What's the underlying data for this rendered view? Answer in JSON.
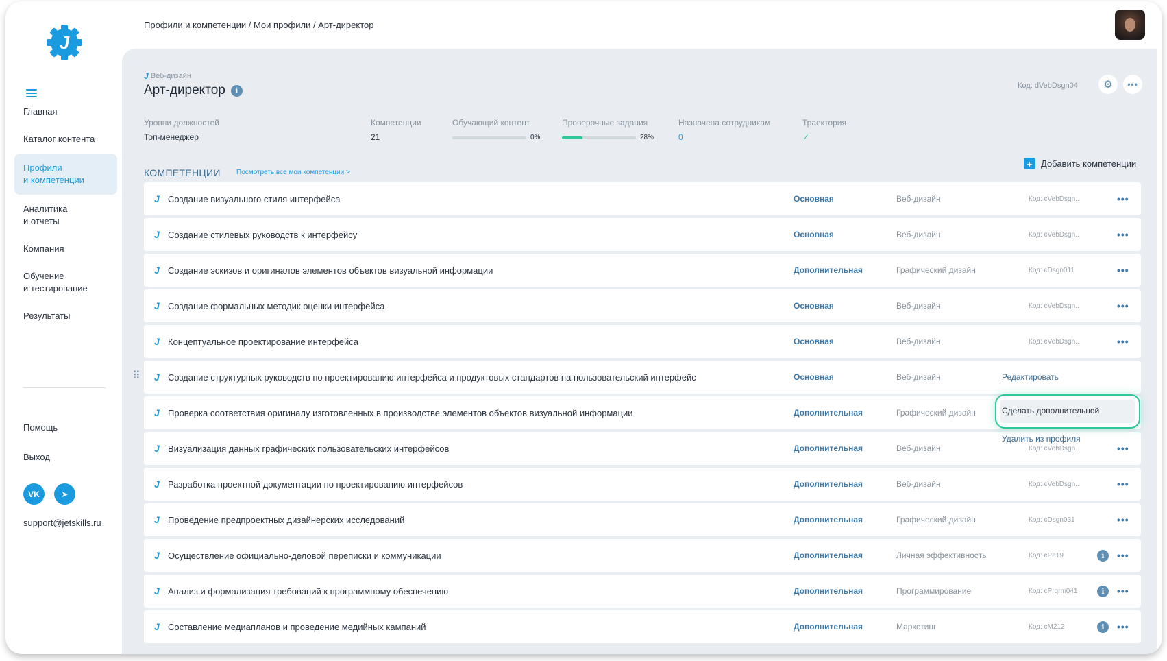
{
  "app": {
    "logo_letter": "J",
    "accent_color": "#1a9be0",
    "success_color": "#2cc89b"
  },
  "sidebar": {
    "items": [
      {
        "label": "Главная"
      },
      {
        "label": "Каталог контента"
      },
      {
        "label": "Профили\nи компетенции",
        "active": true
      },
      {
        "label": "Аналитика\nи отчеты"
      },
      {
        "label": "Компания"
      },
      {
        "label": "Обучение\nи тестирование"
      },
      {
        "label": "Результаты"
      }
    ],
    "help": "Помощь",
    "logout": "Выход",
    "social": [
      {
        "icon": "vk-icon",
        "text": "VK"
      },
      {
        "icon": "telegram-icon",
        "text": "➤"
      }
    ],
    "support_email": "support@jetskills.ru"
  },
  "header": {
    "breadcrumb": "Профили и компетенции / Мои профили / Арт-директор"
  },
  "profile": {
    "category": "Веб-дизайн",
    "title": "Арт-директор",
    "code": "Код: dVebDsgn04",
    "stats": {
      "levels_label": "Уровни должностей",
      "levels_value": "Топ-менеджер",
      "competencies_label": "Компетенции",
      "competencies_value": "21",
      "content_label": "Обучающий контент",
      "content_progress": 0,
      "content_pct": "0%",
      "tasks_label": "Проверочные задания",
      "tasks_progress": 0.28,
      "tasks_pct": "28%",
      "assigned_label": "Назначена сотрудникам",
      "assigned_value": "0",
      "trajectory_label": "Траектория",
      "trajectory_value": "✓"
    }
  },
  "competencies": {
    "section_title": "КОМПЕТЕНЦИИ",
    "view_all_link": "Посмотреть все мои компетенции >",
    "add_button": "Добавить компетенции",
    "rows": [
      {
        "name": "Создание визуального стиля интерфейса",
        "type": "Основная",
        "area": "Веб-дизайн",
        "code": "Код: cVebDsgn..",
        "info": false
      },
      {
        "name": "Создание стилевых руководств к интерфейсу",
        "type": "Основная",
        "area": "Веб-дизайн",
        "code": "Код: cVebDsgn..",
        "info": false
      },
      {
        "name": "Создание эскизов и оригиналов элементов объектов визуальной информации",
        "type": "Дополнительная",
        "area": "Графический дизайн",
        "code": "Код: cDsgn011",
        "info": false
      },
      {
        "name": "Создание формальных методик оценки интерфейса",
        "type": "Основная",
        "area": "Веб-дизайн",
        "code": "Код: cVebDsgn..",
        "info": false
      },
      {
        "name": "Концептуальное проектирование интерфейса",
        "type": "Основная",
        "area": "Веб-дизайн",
        "code": "Код: cVebDsgn..",
        "info": false
      },
      {
        "name": "Создание структурных руководств по проектированию интерфейса и продуктовых стандартов на пользовательский интерфейс",
        "type": "Основная",
        "area": "Веб-дизайн",
        "code": "",
        "info": false,
        "dots": false
      },
      {
        "name": "Проверка соответствия оригиналу изготовленных в производстве элементов объектов визуальной информации",
        "type": "Дополнительная",
        "area": "Графический дизайн",
        "code": "",
        "info": false,
        "dots": false
      },
      {
        "name": "Визуализация данных графических пользовательских интерфейсов",
        "type": "Дополнительная",
        "area": "Веб-дизайн",
        "code": "Код: cVebDsgn..",
        "info": false
      },
      {
        "name": "Разработка проектной документации по проектированию интерфейсов",
        "type": "Дополнительная",
        "area": "Веб-дизайн",
        "code": "Код: cVebDsgn..",
        "info": false
      },
      {
        "name": "Проведение предпроектных дизайнерских исследований",
        "type": "Дополнительная",
        "area": "Графический дизайн",
        "code": "Код: cDsgn031",
        "info": false
      },
      {
        "name": "Осуществление официально-деловой переписки и коммуникации",
        "type": "Дополнительная",
        "area": "Личная эффективность",
        "code": "Код: cPe19",
        "info": true
      },
      {
        "name": "Анализ и формализация требований к программному обеспечению",
        "type": "Дополнительная",
        "area": "Программирование",
        "code": "Код: cPrgrm041",
        "info": true
      },
      {
        "name": "Составление медиапланов и проведение медийных кампаний",
        "type": "Дополнительная",
        "area": "Маркетинг",
        "code": "Код: cM212",
        "info": true
      }
    ]
  },
  "context_menu": {
    "edit": "Редактировать",
    "make_additional": "Сделать дополнительной",
    "remove": "Удалить из профиля"
  }
}
